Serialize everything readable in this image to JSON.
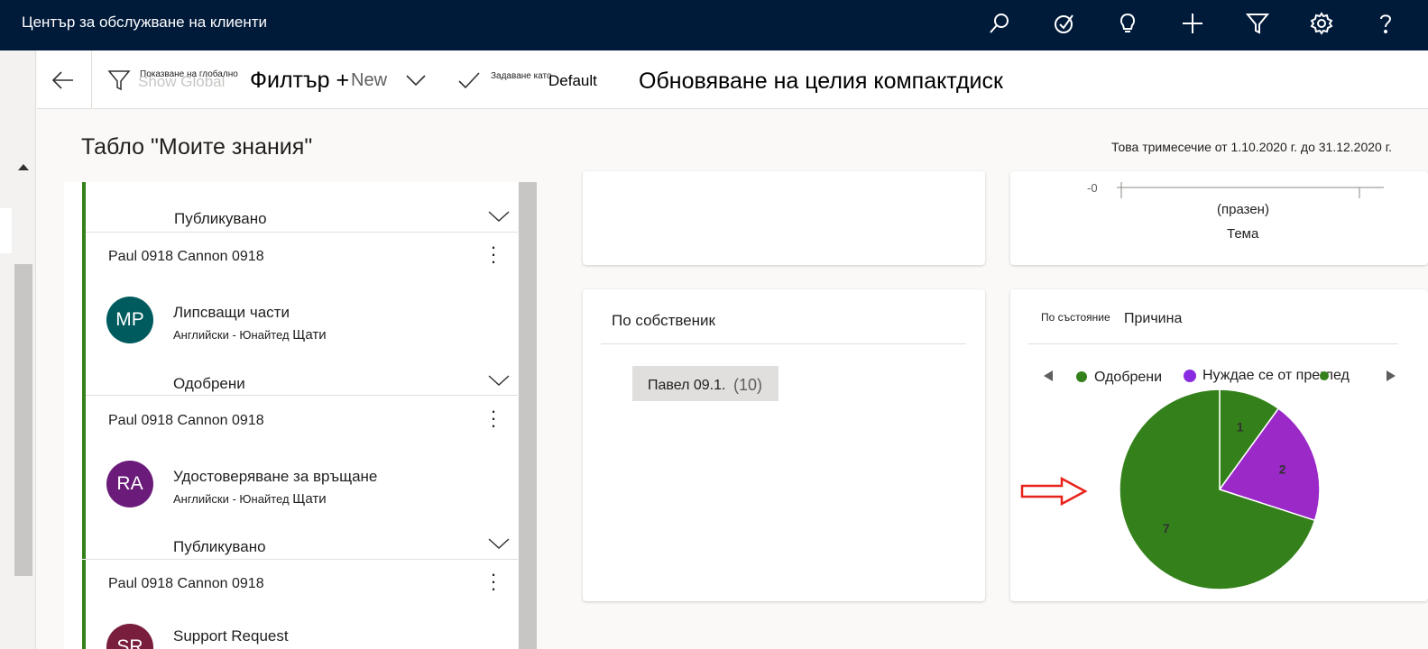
{
  "app": {
    "title": "Център за обслужване на клиенти"
  },
  "topbar_icons": [
    "search-icon",
    "task-check-icon",
    "lightbulb-icon",
    "plus-icon",
    "filter-icon",
    "gear-icon",
    "help-icon"
  ],
  "commandbar": {
    "show_global_small": "Показване на глобално",
    "show_global_ghost": "Show Global",
    "filter_label": "Филтър +",
    "new_label": "New",
    "set_as_small": "Задаване като",
    "default_label": "Default",
    "refresh_label": "Обновяване на целия компактдиск"
  },
  "dashboard": {
    "title": "Табло \"Моите знания\"",
    "period": "Това тримесечие от 1.10.2020 г. до 31.12.2020 г."
  },
  "stream": {
    "items": [
      {
        "status": "Публикувано",
        "owner": "Paul 0918 Cannon 0918",
        "initials": "MP",
        "avatar_color": "#005b5e",
        "title": "Липсващи части",
        "lang_a": "Английски - ",
        "lang_b": "Юнайтед ",
        "lang_c": "Щати"
      },
      {
        "status": "Одобрени",
        "owner": "Paul 0918 Cannon 0918",
        "initials": "RA",
        "avatar_color": "#6b1c7a",
        "title": "Удостоверяване за връщане",
        "lang_a": "Английски - ",
        "lang_b": "Юнайтед ",
        "lang_c": "Щати"
      },
      {
        "status": "Публикувано",
        "owner": "Paul 0918 Cannon 0918",
        "initials": "SR",
        "avatar_color": "#7a1e3e",
        "title": "Support Request"
      }
    ]
  },
  "top_right_chart": {
    "y_tick": "-0",
    "x_value": "(празен)",
    "x_axis_title": "Тема"
  },
  "owner_card": {
    "title": "По собственик",
    "tag_name": "Павел 09.1.",
    "tag_count": "(10)"
  },
  "status_card": {
    "title_small": "По състояние",
    "title": "Причина",
    "legend": [
      {
        "label": "Одобрени",
        "color": "#34811b"
      },
      {
        "label": "Нуждае се от преглед",
        "color": "#8a2be2"
      }
    ]
  },
  "chart_data": {
    "type": "pie",
    "categories": [
      "Одобрени",
      "Нуждае се от преглед",
      "Одобрени"
    ],
    "values": [
      1,
      2,
      7
    ],
    "colors": [
      "#34811b",
      "#9b29c7",
      "#34811b"
    ]
  }
}
